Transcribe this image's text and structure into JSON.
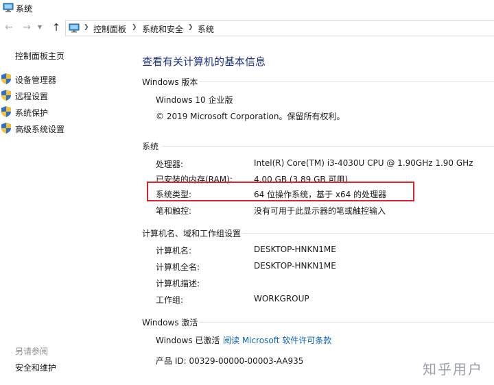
{
  "window": {
    "title": "系统",
    "icon": "monitor-icon"
  },
  "address_bar": {
    "nav_icons": [
      "back-arrow-icon",
      "forward-arrow-icon",
      "dropdown-icon",
      "up-arrow-icon"
    ],
    "crumbs": [
      "控制面板",
      "系统和安全",
      "系统"
    ]
  },
  "sidebar": {
    "home": "控制面板主页",
    "links": [
      {
        "label": "设备管理器",
        "icon": "shield-icon"
      },
      {
        "label": "远程设置",
        "icon": "shield-icon"
      },
      {
        "label": "系统保护",
        "icon": "shield-icon"
      },
      {
        "label": "高级系统设置",
        "icon": "shield-icon"
      }
    ],
    "see_also": "另请参阅",
    "see_also_link": "安全和维护"
  },
  "main": {
    "heading": "查看有关计算机的基本信息",
    "windows_edition": {
      "title": "Windows 版本",
      "edition": "Windows 10 企业版",
      "copyright": "© 2019 Microsoft Corporation。保留所有权利。"
    },
    "system": {
      "title": "系统",
      "rows": [
        {
          "label": "处理器:",
          "value": "Intel(R) Core(TM) i3-4030U CPU @ 1.90GHz   1.90 GHz"
        },
        {
          "label": "已安装的内存(RAM):",
          "value": "4.00 GB (3.89 GB 可用)"
        },
        {
          "label": "系统类型:",
          "value": "64 位操作系统，基于 x64 的处理器"
        },
        {
          "label": "笔和触控:",
          "value": "没有可用于此显示器的笔或触控输入"
        }
      ]
    },
    "computer_name": {
      "title": "计算机名、域和工作组设置",
      "rows": [
        {
          "label": "计算机名:",
          "value": "DESKTOP-HNKN1ME"
        },
        {
          "label": "计算机全名:",
          "value": "DESKTOP-HNKN1ME"
        },
        {
          "label": "计算机描述:",
          "value": ""
        },
        {
          "label": "工作组:",
          "value": "WORKGROUP"
        }
      ]
    },
    "activation": {
      "title": "Windows 激活",
      "status": "Windows 已激活",
      "license_link": "阅读 Microsoft 软件许可条款",
      "product_id": "产品 ID: 00329-00000-00003-AA935"
    }
  },
  "watermark": "知乎用户",
  "colors": {
    "heading": "#1e3287",
    "link": "#0a64b4",
    "highlight_border": "#e0202a"
  }
}
